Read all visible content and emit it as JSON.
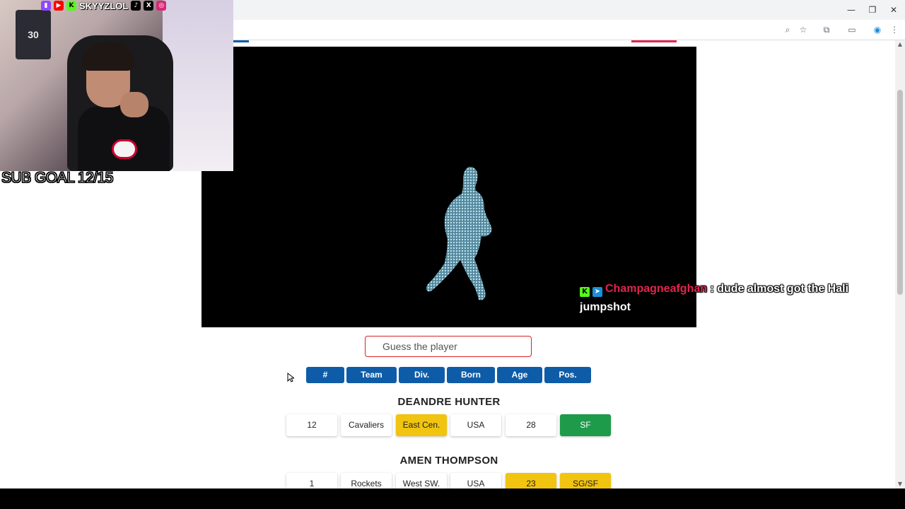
{
  "window_controls": {
    "minimize": "—",
    "restore": "❐",
    "close": "✕"
  },
  "colors": {
    "header_blue": "#0e5ca8",
    "partial_yellow": "#f1c40f",
    "correct_green": "#1e9a4b",
    "accent_red": "#d22",
    "chat_username": "#e3244b"
  },
  "stream": {
    "social_handle": "SKYYZLOL",
    "sub_goal": "SUB GOAL 12/15",
    "jersey_number": "30"
  },
  "chat": {
    "username": "Champagneafghan",
    "separator": " : ",
    "message": "dude almost got the Hali jumpshot"
  },
  "game": {
    "guess_placeholder": "Guess the player",
    "headers": [
      "#",
      "Team",
      "Div.",
      "Born",
      "Age",
      "Pos."
    ],
    "guesses": [
      {
        "name": "DEANDRE HUNTER",
        "cells": [
          {
            "value": "12",
            "status": "none"
          },
          {
            "value": "Cavaliers",
            "status": "none"
          },
          {
            "value": "East Cen.",
            "status": "partial"
          },
          {
            "value": "USA",
            "status": "none"
          },
          {
            "value": "28",
            "status": "none"
          },
          {
            "value": "SF",
            "status": "correct"
          }
        ]
      },
      {
        "name": "AMEN THOMPSON",
        "cells": [
          {
            "value": "1",
            "status": "none"
          },
          {
            "value": "Rockets",
            "status": "none"
          },
          {
            "value": "West SW.",
            "status": "none"
          },
          {
            "value": "USA",
            "status": "none"
          },
          {
            "value": "23",
            "status": "partial"
          },
          {
            "value": "SG/SF",
            "status": "partial"
          }
        ]
      }
    ]
  }
}
